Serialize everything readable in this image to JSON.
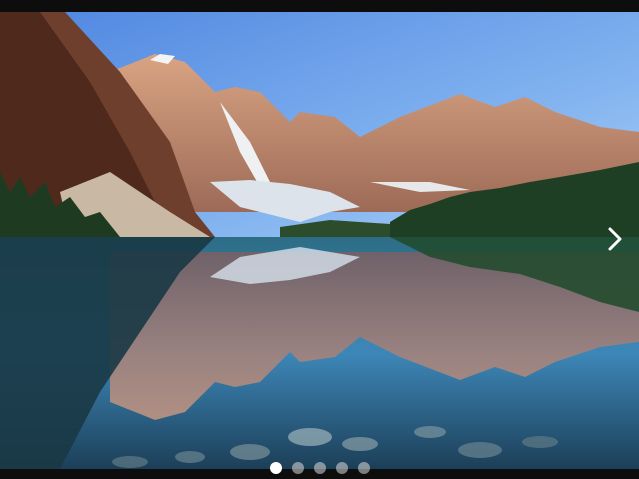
{
  "slider": {
    "slides": [
      {
        "name": "mountain-lake",
        "active": true
      },
      {
        "name": "slide-2",
        "active": false
      },
      {
        "name": "slide-3",
        "active": false
      },
      {
        "name": "slide-4",
        "active": false
      },
      {
        "name": "slide-5",
        "active": false
      }
    ],
    "current_index": 0,
    "next_icon": "chevron-right-icon",
    "colors": {
      "frame": "#0d0d0d",
      "dot_active": "#ffffff",
      "dot_inactive": "#bdbdbd"
    }
  }
}
